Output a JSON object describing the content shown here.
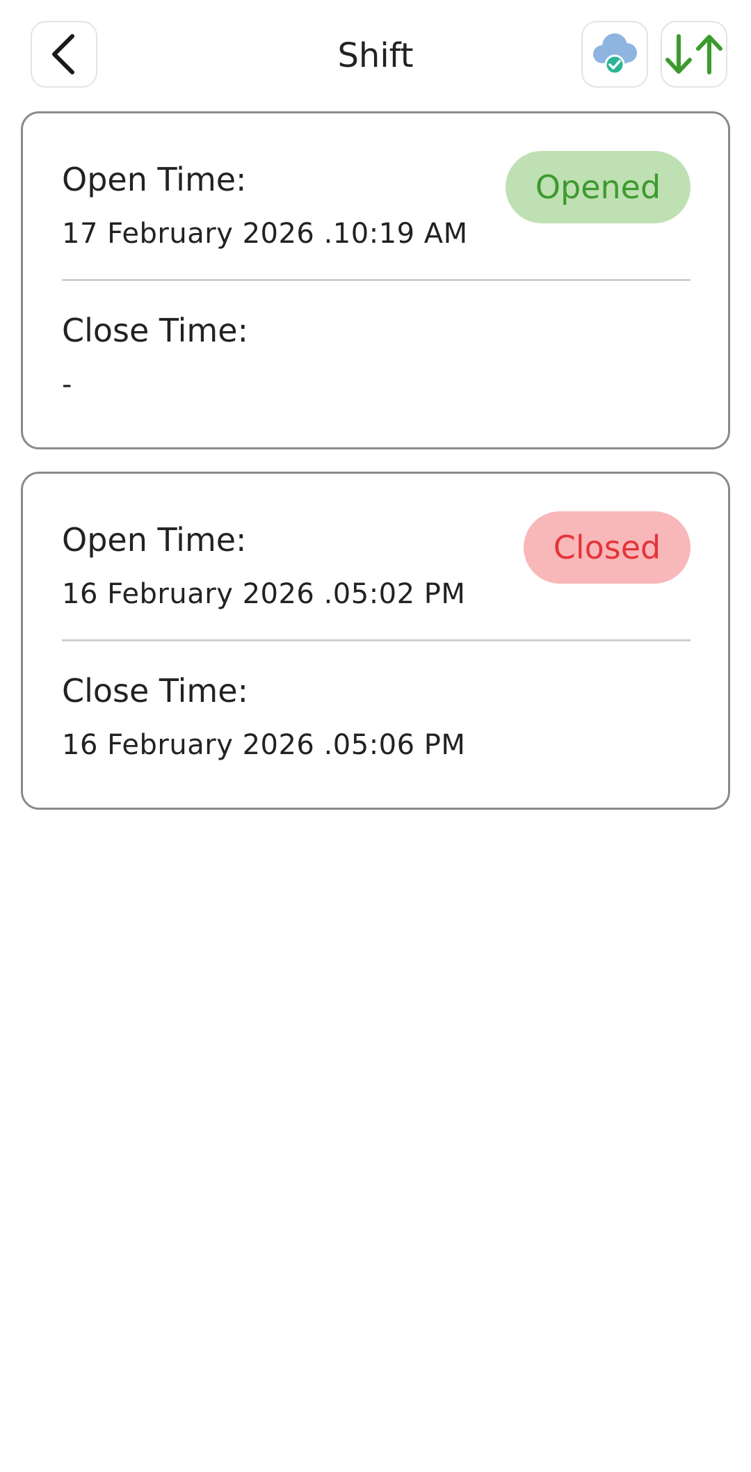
{
  "header": {
    "title": "Shift",
    "back_icon": "chevron-left-icon",
    "sync_icon": "cloud-check-icon",
    "transfer_icon": "arrows-down-up-icon"
  },
  "colors": {
    "opened_badge_bg": "#bfe0b3",
    "opened_badge_text": "#3c9a2e",
    "closed_badge_bg": "#f8b8ba",
    "closed_badge_text": "#e5343b",
    "transfer_icon": "#3c9a2e",
    "cloud": "#8fb4e0",
    "cloud_check": "#2ab597"
  },
  "shifts": [
    {
      "open_label": "Open Time:",
      "open_time": "17 February 2026 .10:19 AM",
      "close_label": "Close Time:",
      "close_time": "-",
      "status": "Opened"
    },
    {
      "open_label": "Open Time:",
      "open_time": "16 February 2026 .05:02 PM",
      "close_label": "Close Time:",
      "close_time": "16 February 2026 .05:06 PM",
      "status": "Closed"
    }
  ]
}
